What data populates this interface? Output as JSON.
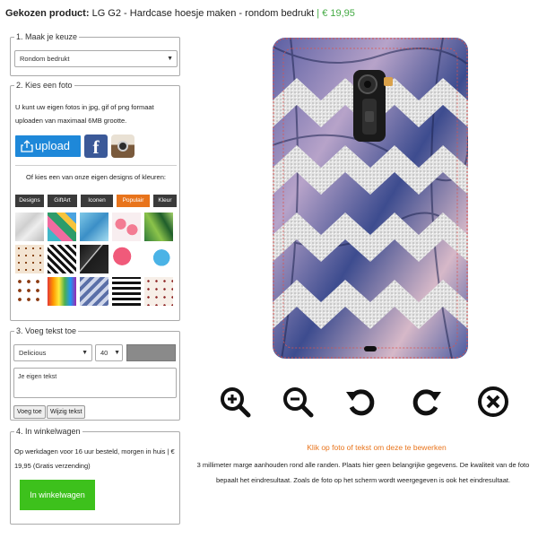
{
  "header": {
    "label": "Gekozen product:",
    "product": "LG G2 - Hardcase hoesje maken - rondom bedrukt",
    "separator": "|",
    "price": "€ 19,95"
  },
  "step1": {
    "legend": "1. Maak je keuze",
    "select_value": "Rondom bedrukt"
  },
  "step2": {
    "legend": "2. Kies een foto",
    "text": "U kunt uw eigen fotos in jpg, gif of png formaat uploaden van maximaal 6MB grootte.",
    "upload_label": "upload",
    "facebook_letter": "f",
    "or_text": "Of kies een van onze eigen designs of kleuren:",
    "tabs": [
      "Designs",
      "GiftArt",
      "Iconen",
      "Populair",
      "Kleur"
    ],
    "active_tab": "Populair"
  },
  "step3": {
    "legend": "3. Voeg tekst toe",
    "font_value": "Delicious",
    "size_value": "40",
    "text_placeholder": "Je eigen tekst",
    "add_label": "Voeg toe",
    "edit_label": "Wijzig tekst"
  },
  "step4": {
    "legend": "4. In winkelwagen",
    "text": "Op werkdagen voor 16 uur besteld, morgen in huis | € 19,95 (Gratis verzending)",
    "cart_label": "In winkelwagen"
  },
  "editor": {
    "click_hint": "Klik op foto of tekst om deze te bewerken",
    "info": "3 millimeter marge aanhouden rond alle randen. Plaats hier geen belangrijke gegevens. De kwaliteit van de foto bepaalt het eindresultaat. Zoals de foto op het scherm wordt weergegeven is ook het eindresultaat."
  },
  "icons": [
    "upload-icon",
    "facebook-icon",
    "instagram-icon",
    "zoom-in-icon",
    "zoom-out-icon",
    "rotate-left-icon",
    "rotate-right-icon",
    "delete-icon"
  ],
  "colors": {
    "accent_orange": "#e8741c",
    "green": "#3dc11c",
    "price_green": "#44aa44",
    "upload_blue": "#1e88d9",
    "dark_tab": "#3a3a3a"
  }
}
